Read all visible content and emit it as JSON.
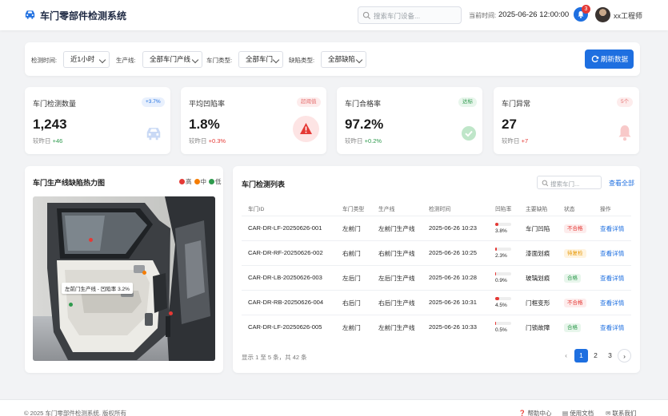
{
  "header": {
    "title": "车门零部件检测系统",
    "search_placeholder": "搜索车门设备...",
    "time_label": "当前时间:",
    "time_value": "2025-06-26 12:00:00",
    "notification_count": "3",
    "user_name": "xx工程师"
  },
  "filters": {
    "time_label": "检测时间:",
    "time_value": "近1小时",
    "line_label": "生产线:",
    "line_value": "全部车门产线",
    "type_label": "车门类型:",
    "type_value": "全部车门",
    "defect_label": "缺陷类型:",
    "defect_value": "全部缺陷",
    "refresh_label": "刷新数据"
  },
  "stats": [
    {
      "title": "车门检测数量",
      "badge": "+3.7%",
      "value": "1,243",
      "sub_label": "较昨日",
      "delta": "+46",
      "icon": "car-icon"
    },
    {
      "title": "平均凹陷率",
      "badge": "超阈值",
      "value": "1.8%",
      "sub_label": "较昨日",
      "delta": "+0.3%",
      "icon": "warning-icon"
    },
    {
      "title": "车门合格率",
      "badge": "达标",
      "value": "97.2%",
      "sub_label": "较昨日",
      "delta": "+0.2%",
      "icon": "check-circle-icon"
    },
    {
      "title": "车门异常",
      "badge": "5个",
      "value": "27",
      "sub_label": "较昨日",
      "delta": "+7",
      "icon": "bell-icon"
    }
  ],
  "heatmap": {
    "title": "车门生产线缺陷热力图",
    "legend": [
      "高",
      "中",
      "低"
    ],
    "legend_colors": [
      "#e53935",
      "#f57c00",
      "#2e9a4d"
    ],
    "tooltip": "左前门生产线 - 凹陷率 3.2%"
  },
  "table": {
    "title": "车门检测列表",
    "search_placeholder": "搜索车门...",
    "view_all": "查看全部",
    "columns": [
      "车门ID",
      "车门类型",
      "生产线",
      "检测时间",
      "凹陷率",
      "主要缺陷",
      "状态",
      "操作"
    ],
    "rows": [
      {
        "id": "CAR-DR-LF-20250626-001",
        "type": "左前门",
        "line": "左前门生产线",
        "time": "2025-06-26 10:23",
        "rate": "3.8%",
        "rate_fill": 0.2,
        "defect": "车门凹陷",
        "status": "不合格",
        "status_kind": "bad",
        "action": "查看详情"
      },
      {
        "id": "CAR-DR-RF-20250626-002",
        "type": "右前门",
        "line": "右前门生产线",
        "time": "2025-06-26 10:25",
        "rate": "2.3%",
        "rate_fill": 0.12,
        "defect": "漆面划痕",
        "status": "待复检",
        "status_kind": "warn",
        "action": "查看详情"
      },
      {
        "id": "CAR-DR-LB-20250626-003",
        "type": "左后门",
        "line": "左后门生产线",
        "time": "2025-06-26 10:28",
        "rate": "0.9%",
        "rate_fill": 0.05,
        "defect": "玻璃划痕",
        "status": "合格",
        "status_kind": "ok",
        "action": "查看详情"
      },
      {
        "id": "CAR-DR-RB-20250626-004",
        "type": "右后门",
        "line": "右后门生产线",
        "time": "2025-06-26 10:31",
        "rate": "4.5%",
        "rate_fill": 0.24,
        "defect": "门框变形",
        "status": "不合格",
        "status_kind": "bad",
        "action": "查看详情"
      },
      {
        "id": "CAR-DR-LF-20250626-005",
        "type": "左前门",
        "line": "左前门生产线",
        "time": "2025-06-26 10:33",
        "rate": "0.5%",
        "rate_fill": 0.03,
        "defect": "门锁故障",
        "status": "合格",
        "status_kind": "ok",
        "action": "查看详情"
      }
    ],
    "footer_info": "显示 1 至 5 条，共 42 条",
    "pages": [
      "1",
      "2",
      "3"
    ],
    "current_page": "1",
    "prev": "‹",
    "next": "›"
  },
  "footer": {
    "copyright": "© 2025 车门零部件检测系统. 版权所有",
    "links": [
      "帮助中心",
      "使用文档",
      "联系我们"
    ]
  },
  "colors": {
    "accent": "#1e6fe0",
    "danger": "#e53935",
    "success": "#2e9a4d",
    "warning": "#f57c00"
  }
}
